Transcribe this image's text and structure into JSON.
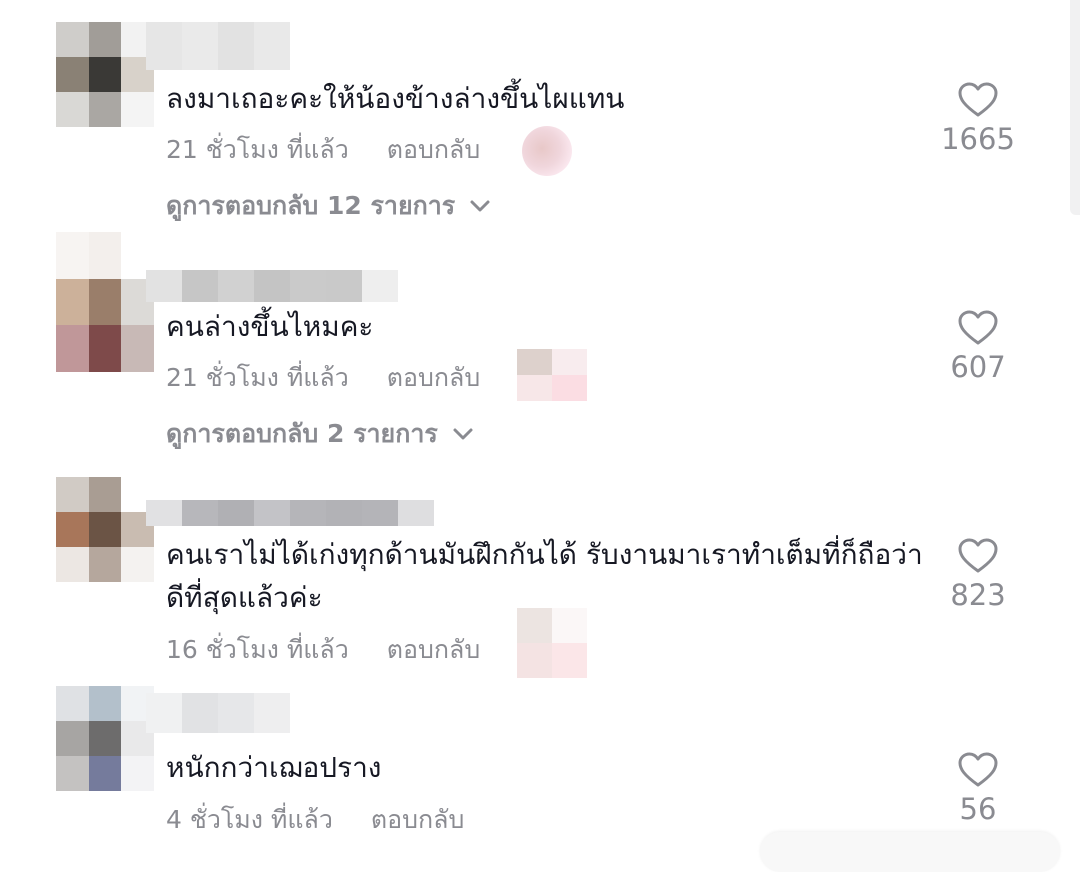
{
  "comments": [
    {
      "text": "ลงมาเถอะคะให้น้องข้างล่างขึ้นไผแทน",
      "time": "21 ชั่วโมง ที่แล้ว",
      "reply": "ตอบกลับ",
      "likes": "1665",
      "view_replies": "ดูการตอบกลับ 12 รายการ"
    },
    {
      "text": "คนล่างขึ้นไหมคะ",
      "time": "21 ชั่วโมง ที่แล้ว",
      "reply": "ตอบกลับ",
      "likes": "607",
      "view_replies": "ดูการตอบกลับ 2 รายการ"
    },
    {
      "text": "คนเราไม่ได้เก่งทุกด้านมันฝึกกันได้ รับงานมาเราทำเต็มที่ก็ถือว่าดีที่สุดแล้วค่ะ",
      "time": "16 ชั่วโมง ที่แล้ว",
      "reply": "ตอบกลับ",
      "likes": "823"
    },
    {
      "text": "หนักกว่าเฌอปราง",
      "time": "4 ชั่วโมง ที่แล้ว",
      "reply": "ตอบกลับ",
      "likes": "56"
    }
  ],
  "icons": {
    "like": "heart-outline-icon",
    "expand": "chevron-down-icon"
  },
  "colors": {
    "primary_text": "#161823",
    "secondary_text": "#8a8b91",
    "background": "#ffffff"
  }
}
